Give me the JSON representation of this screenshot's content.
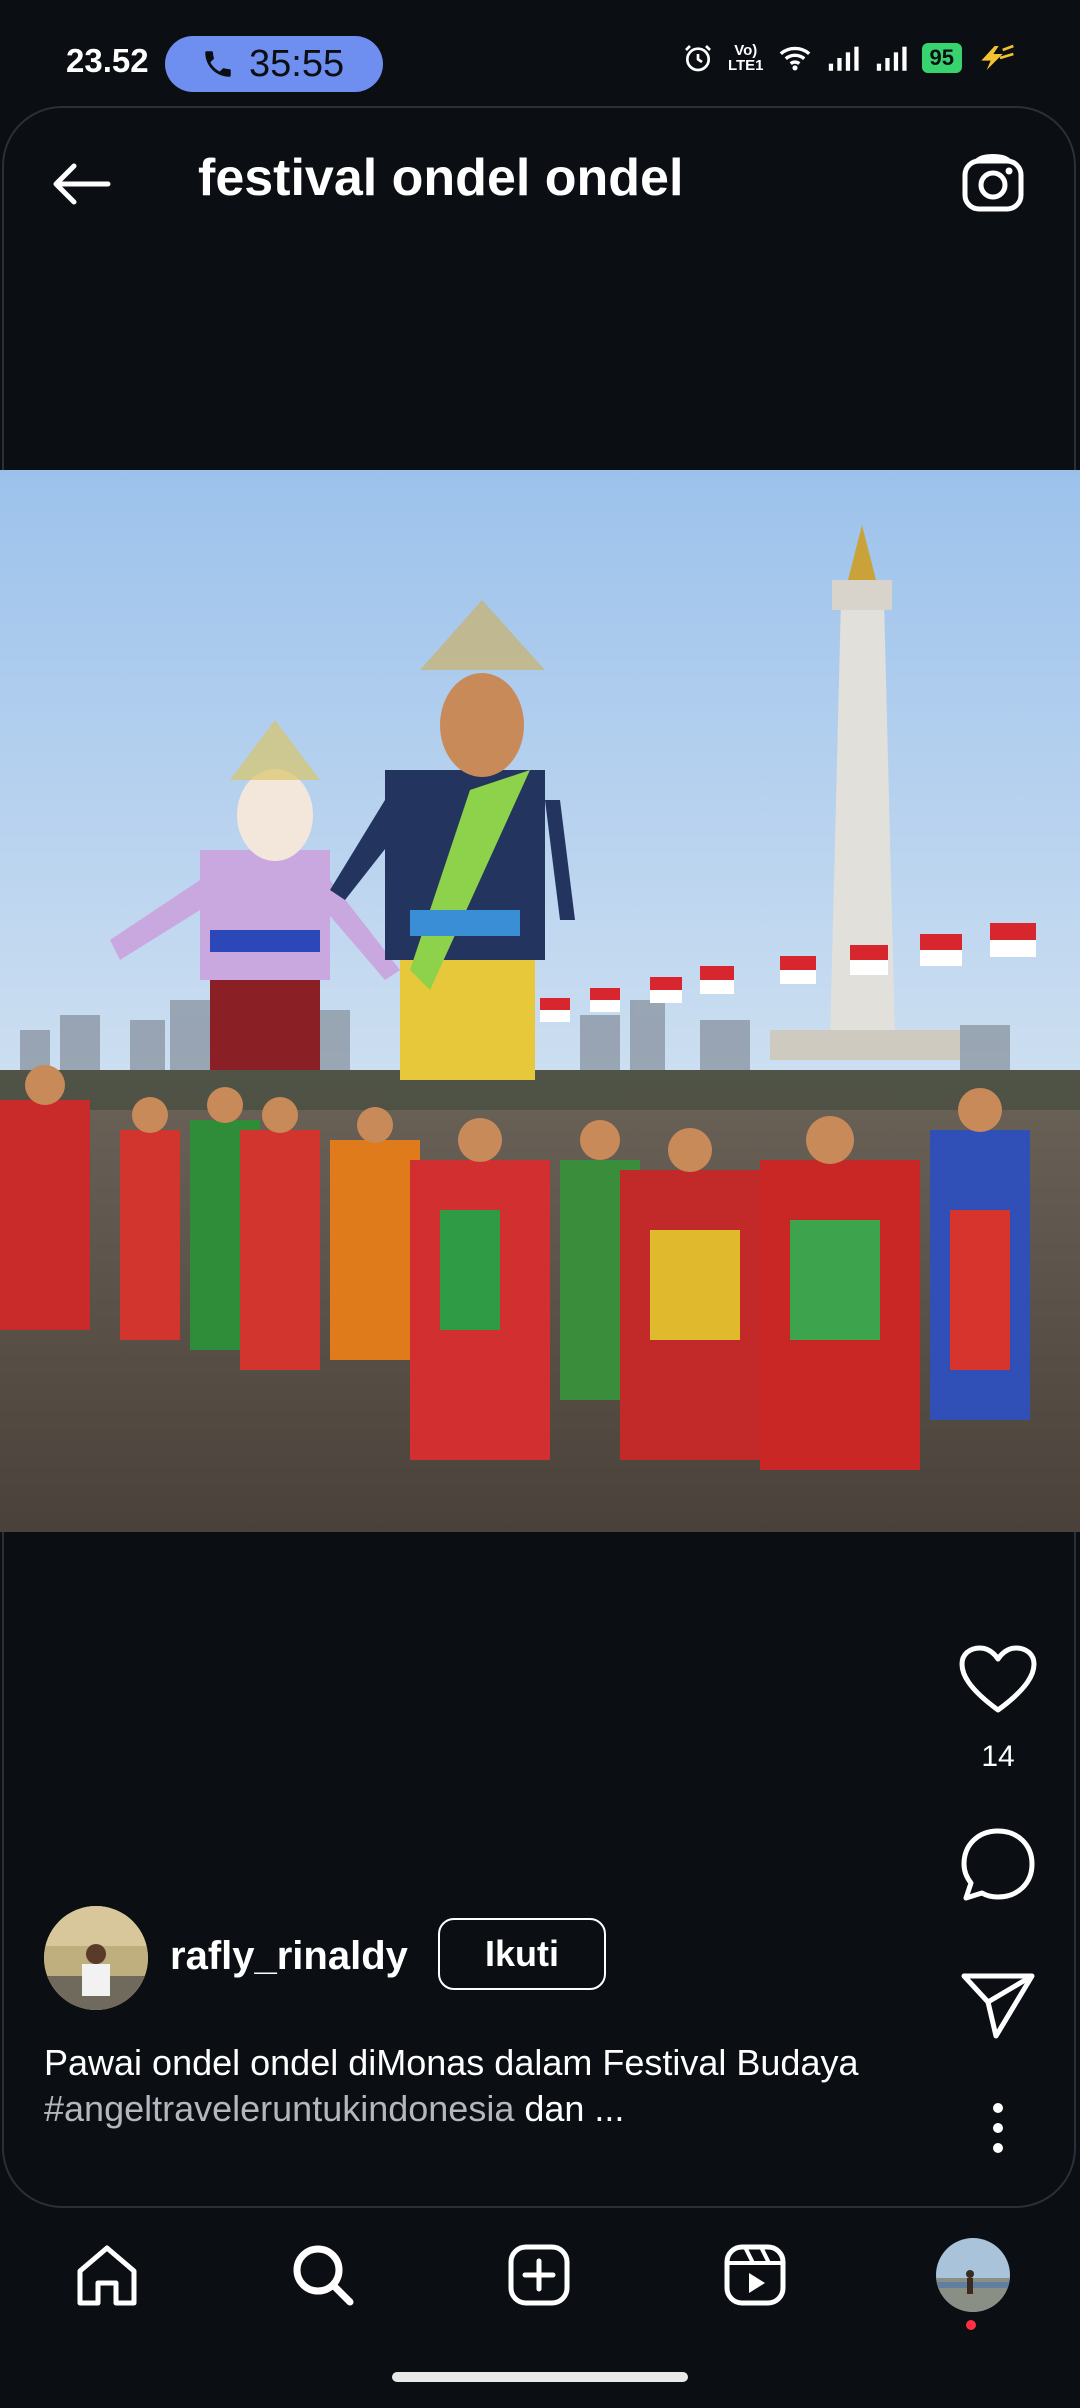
{
  "status_bar": {
    "time": "23.52",
    "call_timer": "35:55",
    "battery_level": "95",
    "icons": [
      "alarm-icon",
      "volte-lte-icon",
      "wifi-icon",
      "signal-icon",
      "signal-icon",
      "battery-icon",
      "charging-icon"
    ]
  },
  "header": {
    "title": "festival ondel ondel",
    "back_icon": "arrow-left-icon",
    "camera_icon": "camera-icon"
  },
  "post": {
    "likes": "14",
    "author": "rafly_rinaldy",
    "follow_label": "Ikuti",
    "caption_text": "Pawai ondel ondel diMonas dalam Festival Budaya",
    "caption_hashtag": "#angeltraveleruntukindonesia",
    "caption_more": " dan ..."
  },
  "bottom_nav": {
    "items": [
      "home-icon",
      "search-icon",
      "create-icon",
      "reels-icon",
      "profile-avatar"
    ]
  },
  "colors": {
    "background": "#0b0f14",
    "call_pill": "#6f8ff0",
    "battery": "#36d36e",
    "notification": "#ff3040"
  }
}
